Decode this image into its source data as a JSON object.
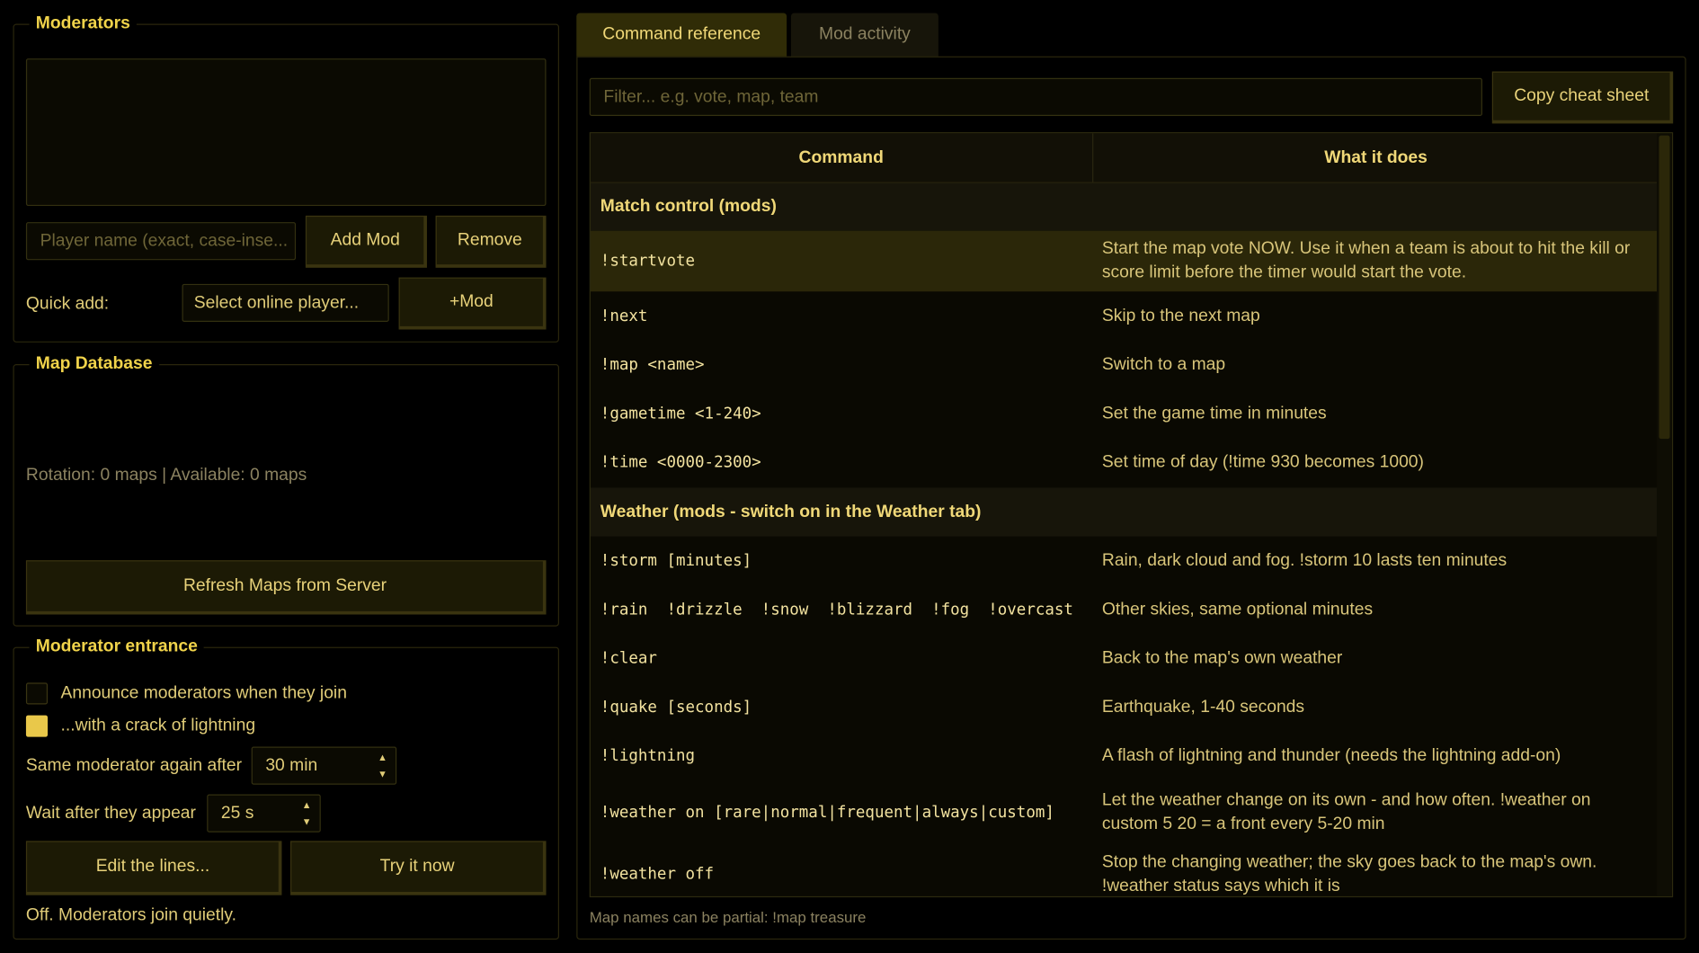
{
  "moderators": {
    "title": "Moderators",
    "player_placeholder": "Player name (exact, case-inse...",
    "add_label": "Add Mod",
    "remove_label": "Remove",
    "quick_add_label": "Quick add:",
    "select_placeholder": "Select online player...",
    "plus_mod_label": "+Mod"
  },
  "map_database": {
    "title": "Map Database",
    "status": "Rotation: 0 maps | Available: 0 maps",
    "refresh_label": "Refresh Maps from Server"
  },
  "entrance": {
    "title": "Moderator entrance",
    "announce_label": "Announce moderators when they join",
    "announce_checked": false,
    "lightning_label": "...with a crack of lightning",
    "lightning_checked": true,
    "same_mod_label": "Same moderator again after",
    "same_mod_value": "30 min",
    "wait_label": "Wait after they appear",
    "wait_value": "25 s",
    "edit_label": "Edit the lines...",
    "try_label": "Try it now",
    "status": "Off. Moderators join quietly."
  },
  "tabs": [
    {
      "label": "Command reference",
      "active": true
    },
    {
      "label": "Mod activity",
      "active": false
    }
  ],
  "reference": {
    "filter_placeholder": "Filter... e.g. vote, map, team",
    "copy_label": "Copy cheat sheet",
    "col_command": "Command",
    "col_desc": "What it does",
    "sections": [
      {
        "title": "Match control (mods)"
      },
      {
        "title": "Weather (mods - switch on in the Weather tab)"
      }
    ],
    "rows": [
      {
        "cmd": "!startvote",
        "desc": "Start the map vote NOW. Use it when a team is about to hit the kill or score limit before the timer would start the vote."
      },
      {
        "cmd": "!next",
        "desc": "Skip to the next map"
      },
      {
        "cmd": "!map <name>",
        "desc": "Switch to a map"
      },
      {
        "cmd": "!gametime <1-240>",
        "desc": "Set the game time in minutes"
      },
      {
        "cmd": "!time <0000-2300>",
        "desc": "Set time of day (!time 930 becomes 1000)"
      },
      {
        "cmd": "!storm [minutes]",
        "desc": "Rain, dark cloud and fog. !storm 10 lasts ten minutes"
      },
      {
        "cmd": "!rain  !drizzle  !snow  !blizzard  !fog  !overcast",
        "desc": "Other skies, same optional minutes"
      },
      {
        "cmd": "!clear",
        "desc": "Back to the map's own weather"
      },
      {
        "cmd": "!quake [seconds]",
        "desc": "Earthquake, 1-40 seconds"
      },
      {
        "cmd": "!lightning",
        "desc": "A flash of lightning and thunder (needs the lightning add-on)"
      },
      {
        "cmd": "!weather on [rare|normal|frequent|always|custom]",
        "desc": "Let the weather change on its own - and how often. !weather on custom 5 20 = a front every 5-20 min"
      },
      {
        "cmd": "!weather off",
        "desc": "Stop the changing weather; the sky goes back to the map's own. !weather status says which it is"
      }
    ],
    "footer": "Map names can be partial: !map treasure"
  }
}
